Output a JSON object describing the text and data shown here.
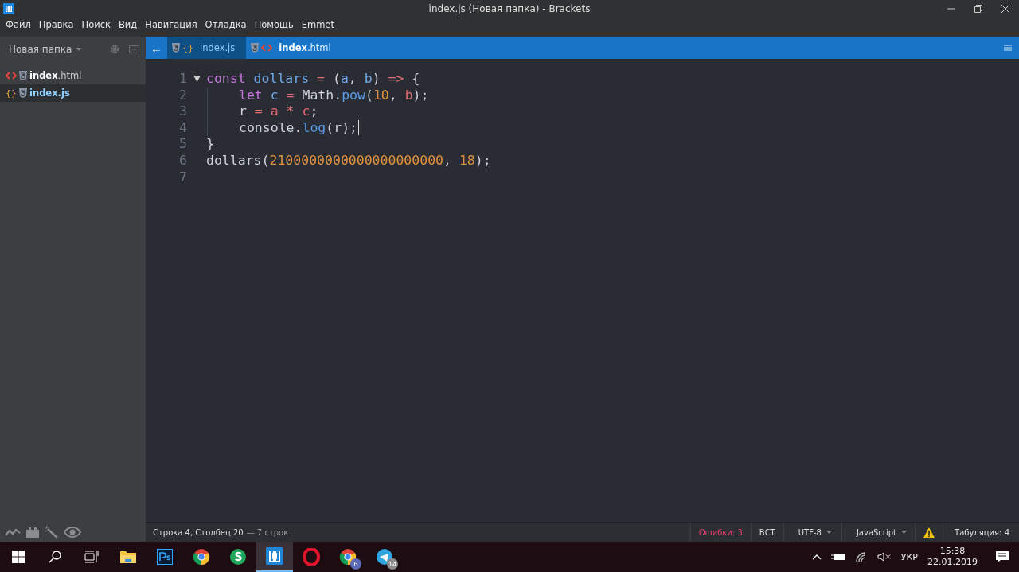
{
  "window": {
    "title": "index.js (Новая папка) - Brackets"
  },
  "menu": [
    "Файл",
    "Правка",
    "Поиск",
    "Вид",
    "Навигация",
    "Отладка",
    "Помощь",
    "Emmet"
  ],
  "sidebar": {
    "project": "Новая папка",
    "files": [
      {
        "name": "**index**.html",
        "kind": "html",
        "selected": false
      },
      {
        "name": "index.js",
        "kind": "js",
        "icon_text": "{}",
        "selected": true
      }
    ]
  },
  "tab_bar": {
    "back": "←",
    "tabs": [
      {
        "name": "index.js",
        "kind": "js",
        "icon_text": "{}",
        "selected": true
      },
      {
        "name": "**index**.html",
        "kind": "html",
        "selected": false
      }
    ]
  },
  "editor": {
    "lines": [
      {
        "number": "1",
        "fold": true,
        "indented": false,
        "cursor": false,
        "tokens": [
          {
            "text": "const",
            "kind": "keyword"
          },
          {
            "text": " dollars",
            "kind": "def"
          },
          {
            "text": " =",
            "kind": "op"
          },
          {
            "text": " (",
            "kind": "plain"
          },
          {
            "text": "a",
            "kind": "def"
          },
          {
            "text": ",",
            "kind": "plain"
          },
          {
            "text": " b",
            "kind": "def"
          },
          {
            "text": ")",
            "kind": "plain"
          },
          {
            "text": " =>",
            "kind": "op"
          },
          {
            "text": " {",
            "kind": "plain"
          }
        ]
      },
      {
        "number": "2",
        "fold": false,
        "indented": true,
        "cursor": false,
        "tokens": [
          {
            "text": "let",
            "kind": "keyword"
          },
          {
            "text": " c",
            "kind": "def"
          },
          {
            "text": " =",
            "kind": "op"
          },
          {
            "text": " Math.",
            "kind": "plain"
          },
          {
            "text": "pow",
            "kind": "prop"
          },
          {
            "text": "(",
            "kind": "plain"
          },
          {
            "text": "10",
            "kind": "num"
          },
          {
            "text": ",",
            "kind": "plain"
          },
          {
            "text": " b",
            "kind": "var2"
          },
          {
            "text": ");",
            "kind": "plain"
          }
        ]
      },
      {
        "number": "3",
        "fold": false,
        "indented": true,
        "cursor": false,
        "tokens": [
          {
            "text": "r",
            "kind": "plain"
          },
          {
            "text": " =",
            "kind": "op"
          },
          {
            "text": " a",
            "kind": "var2"
          },
          {
            "text": " *",
            "kind": "op"
          },
          {
            "text": " c",
            "kind": "var2"
          },
          {
            "text": ";",
            "kind": "plain"
          }
        ]
      },
      {
        "number": "4",
        "fold": false,
        "indented": true,
        "cursor": true,
        "tokens": [
          {
            "text": "console.",
            "kind": "plain"
          },
          {
            "text": "log",
            "kind": "prop"
          },
          {
            "text": "(r);",
            "kind": "plain"
          }
        ]
      },
      {
        "number": "5",
        "fold": false,
        "indented": false,
        "cursor": false,
        "tokens": [
          {
            "text": "}",
            "kind": "plain"
          }
        ]
      },
      {
        "number": "6",
        "fold": false,
        "indented": false,
        "cursor": false,
        "tokens": [
          {
            "text": "dollars(",
            "kind": "plain"
          },
          {
            "text": "2100000000000000000000",
            "kind": "num"
          },
          {
            "text": ",",
            "kind": "plain"
          },
          {
            "text": " 18",
            "kind": "num"
          },
          {
            "text": ");",
            "kind": "plain"
          }
        ]
      },
      {
        "number": "7",
        "fold": false,
        "indented": false,
        "cursor": false
      }
    ]
  },
  "status_bar": {
    "position": "Строка 4, Столбец 20",
    "lines": "— 7 строк",
    "errors": "Ошибки: 3",
    "mode": "ВСТ",
    "encoding": "UTF-8",
    "language": "JavaScript",
    "indent": "Табуляция: 4"
  },
  "taskbar": {
    "apps": [
      {
        "kind": "explorer",
        "selected": false
      },
      {
        "kind": "photoshop",
        "selected": false
      },
      {
        "kind": "chrome",
        "selected": false
      },
      {
        "kind": "s",
        "selected": false
      },
      {
        "kind": "brackets",
        "selected": true
      },
      {
        "kind": "opera",
        "selected": false
      },
      {
        "kind": "chrome",
        "selected": false,
        "badge": "6"
      },
      {
        "kind": "telegram",
        "selected": false,
        "badge": "14"
      }
    ],
    "language": "УКР",
    "time": "15:38",
    "date": "22.01.2019"
  }
}
